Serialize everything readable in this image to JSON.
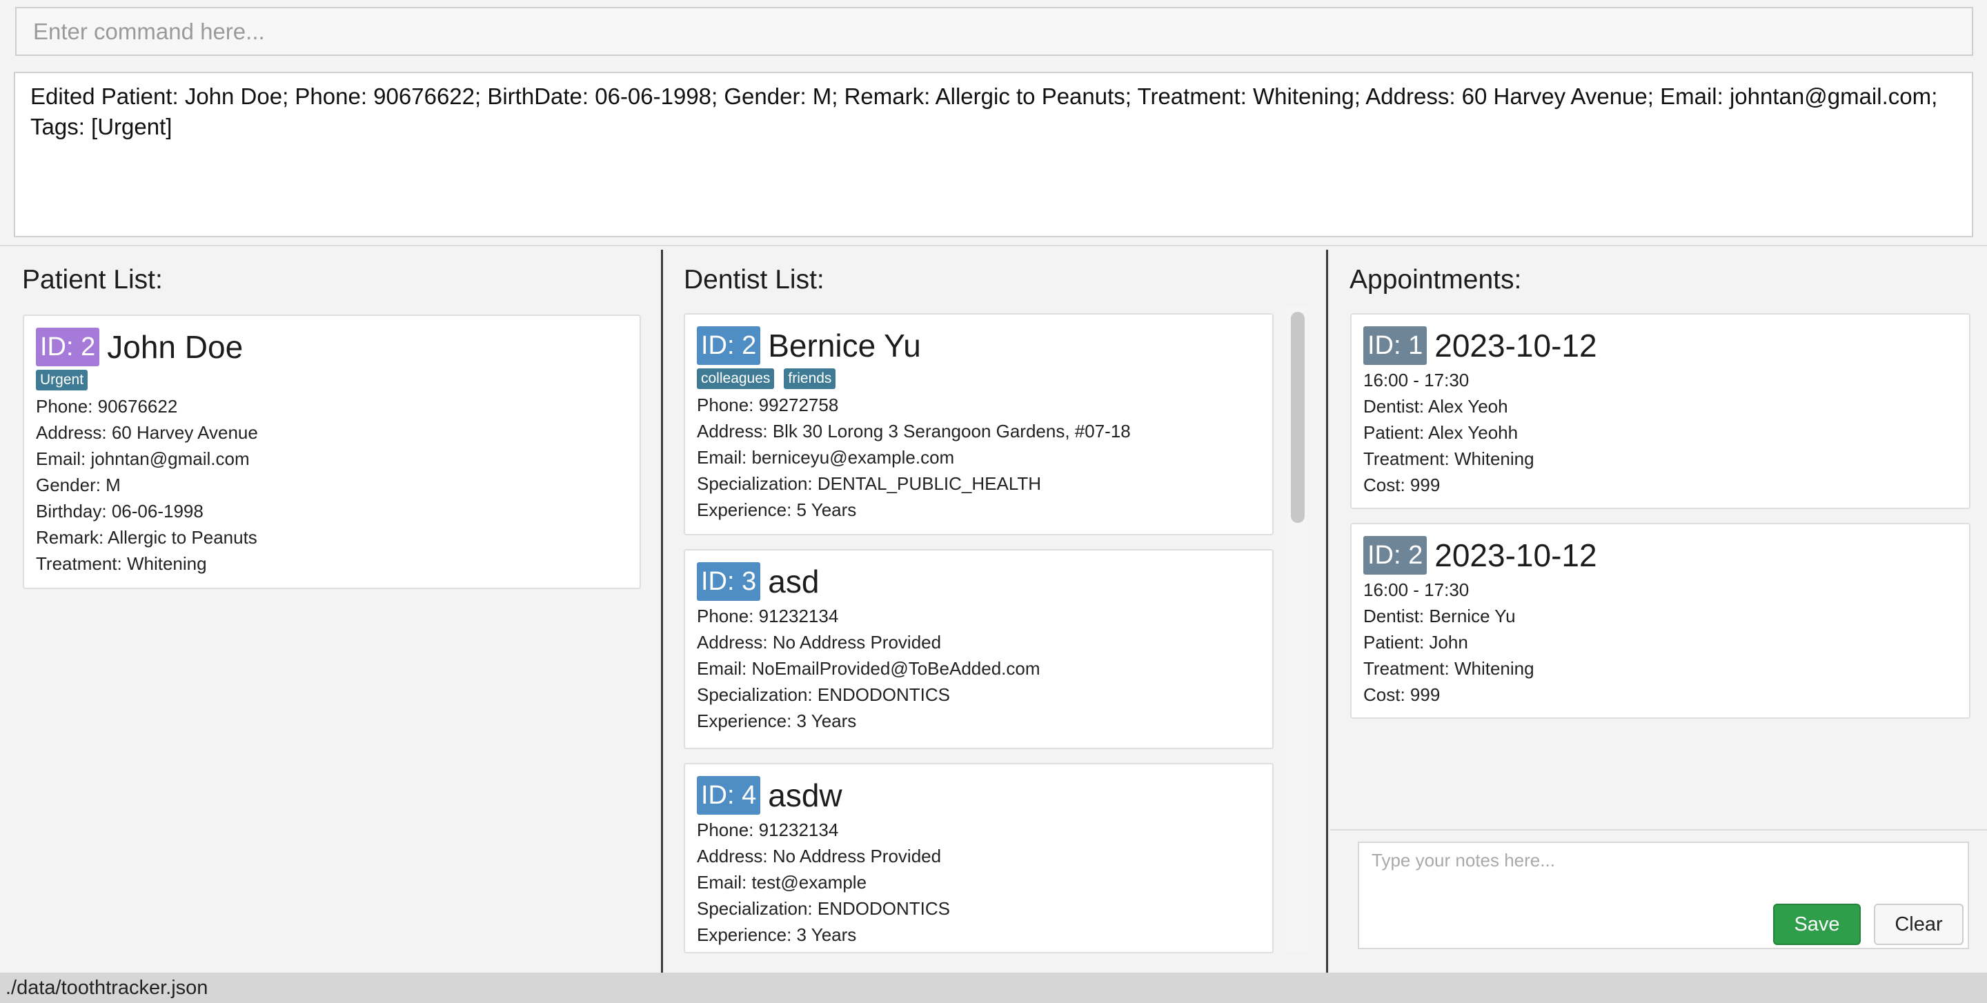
{
  "command": {
    "placeholder": "Enter command here...",
    "value": ""
  },
  "result": {
    "text": "Edited Patient: John Doe; Phone: 90676622; BirthDate: 06-06-1998; Gender: M; Remark: Allergic to Peanuts; Treatment: Whitening; Address: 60 Harvey Avenue; Email: johntan@gmail.com; Tags: [Urgent]"
  },
  "patients": {
    "title": "Patient List:",
    "badge_color": "#a57ad9",
    "items": [
      {
        "id": "ID: 2",
        "name": "John Doe",
        "tags": [
          "Urgent"
        ],
        "phone": "Phone: 90676622",
        "address": "Address: 60 Harvey Avenue",
        "email": "Email: johntan@gmail.com",
        "gender": "Gender: M",
        "birthday": "Birthday: 06-06-1998",
        "remark": "Remark: Allergic to Peanuts",
        "treatment": "Treatment: Whitening"
      }
    ]
  },
  "dentists": {
    "title": "Dentist List:",
    "badge_color": "#4f8ec5",
    "items": [
      {
        "id": "ID: 2",
        "name": "Bernice Yu",
        "tags": [
          "colleagues",
          "friends"
        ],
        "phone": "Phone: 99272758",
        "address": "Address: Blk 30 Lorong 3 Serangoon Gardens, #07-18",
        "email": "Email: berniceyu@example.com",
        "specialization": "Specialization: DENTAL_PUBLIC_HEALTH",
        "experience": "Experience: 5 Years"
      },
      {
        "id": "ID: 3",
        "name": "asd",
        "tags": [],
        "phone": "Phone: 91232134",
        "address": "Address: No Address Provided",
        "email": "Email: NoEmailProvided@ToBeAdded.com",
        "specialization": "Specialization: ENDODONTICS",
        "experience": "Experience: 3 Years"
      },
      {
        "id": "ID: 4",
        "name": "asdw",
        "tags": [],
        "phone": "Phone: 91232134",
        "address": "Address: No Address Provided",
        "email": "Email: test@example",
        "specialization": "Specialization: ENDODONTICS",
        "experience": "Experience: 3 Years"
      }
    ]
  },
  "appointments": {
    "title": "Appointments:",
    "badge_color": "#6e8597",
    "items": [
      {
        "id": "ID: 1",
        "date": "2023-10-12",
        "time": "16:00 - 17:30",
        "dentist": "Dentist: Alex Yeoh",
        "patient": "Patient: Alex Yeohh",
        "treatment": "Treatment: Whitening",
        "cost": "Cost: 999"
      },
      {
        "id": "ID: 2",
        "date": "2023-10-12",
        "time": "16:00 - 17:30",
        "dentist": "Dentist: Bernice Yu",
        "patient": "Patient: John",
        "treatment": "Treatment: Whitening",
        "cost": "Cost: 999"
      }
    ]
  },
  "notes": {
    "placeholder": "Type your notes here...",
    "save_label": "Save",
    "clear_label": "Clear"
  },
  "tag_color": "#3f7b95",
  "status": {
    "path": "./data/toothtracker.json"
  }
}
